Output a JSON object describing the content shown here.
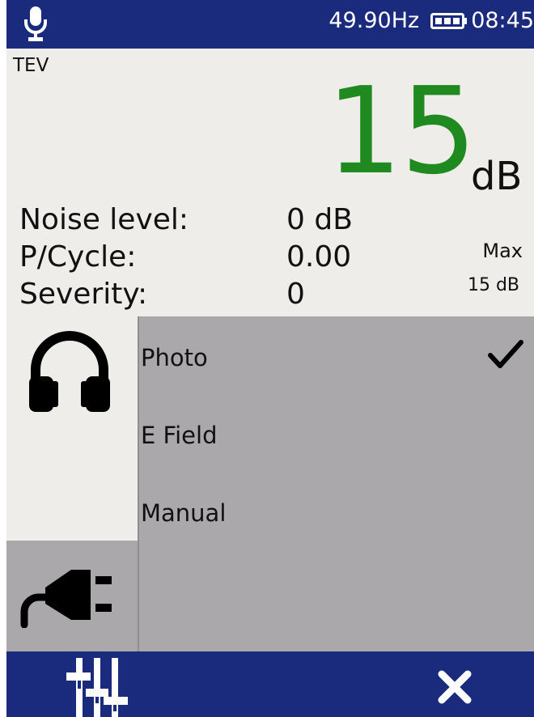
{
  "status": {
    "frequency": "49.90Hz",
    "time": "08:45",
    "mic_icon": "microphone-icon",
    "battery_icon": "battery-icon"
  },
  "measurement": {
    "mode": "TEV",
    "value": "15",
    "unit": "dB",
    "rows": [
      {
        "label": "Noise level:",
        "value": "0 dB"
      },
      {
        "label": "P/Cycle:",
        "value": "0.00"
      },
      {
        "label": "Severity:",
        "value": "0"
      }
    ],
    "max_label": "Max",
    "max_value": "15  dB"
  },
  "panel": {
    "options": [
      {
        "label": "Photo",
        "selected": true
      },
      {
        "label": "E Field",
        "selected": false
      },
      {
        "label": "Manual",
        "selected": false
      }
    ],
    "side_icons": [
      "headphones-icon",
      "plug-icon"
    ]
  },
  "toolbar": {
    "icons": [
      "sliders-icon",
      "close-icon"
    ]
  },
  "colors": {
    "bar_blue": "#1a2a7c",
    "value_green": "#1f8a1f",
    "panel_gray": "#aaa8ab",
    "background": "#efedea"
  }
}
